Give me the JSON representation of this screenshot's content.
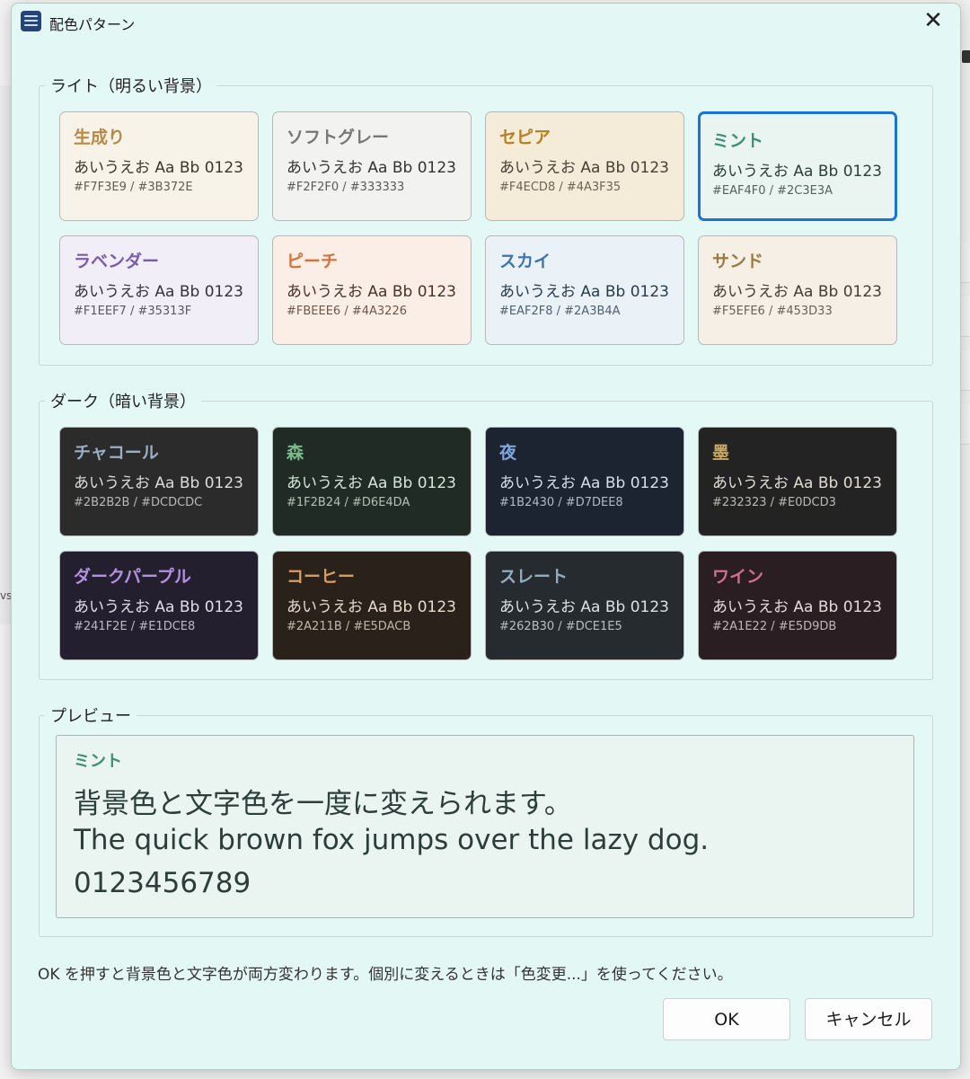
{
  "window": {
    "title": "配色パターン",
    "close_symbol": "✕"
  },
  "background_app": {
    "left_fragment": "vs"
  },
  "light_group": {
    "label": "ライト（明るい背景）",
    "items": [
      {
        "name": "生成り",
        "sample": "あいうえお Aa Bb 0123",
        "codes": "#F7F3E9 / #3B372E",
        "bg": "#F7F3E9",
        "fg": "#3B372E",
        "accent": "#b98a45",
        "selected": false
      },
      {
        "name": "ソフトグレー",
        "sample": "あいうえお Aa Bb 0123",
        "codes": "#F2F2F0 / #333333",
        "bg": "#F2F2F0",
        "fg": "#333333",
        "accent": "#777777",
        "selected": false
      },
      {
        "name": "セピア",
        "sample": "あいうえお Aa Bb 0123",
        "codes": "#F4ECD8 / #4A3F35",
        "bg": "#F4ECD8",
        "fg": "#4A3F35",
        "accent": "#b57f22",
        "selected": false
      },
      {
        "name": "ミント",
        "sample": "あいうえお Aa Bb 0123",
        "codes": "#EAF4F0 / #2C3E3A",
        "bg": "#EAF4F0",
        "fg": "#2C3E3A",
        "accent": "#3b8f73",
        "selected": true
      },
      {
        "name": "ラベンダー",
        "sample": "あいうえお Aa Bb 0123",
        "codes": "#F1EEF7 / #35313F",
        "bg": "#F1EEF7",
        "fg": "#35313F",
        "accent": "#7a5cae",
        "selected": false
      },
      {
        "name": "ピーチ",
        "sample": "あいうえお Aa Bb 0123",
        "codes": "#FBEEE6 / #4A3226",
        "bg": "#FBEEE6",
        "fg": "#4A3226",
        "accent": "#d4723e",
        "selected": false
      },
      {
        "name": "スカイ",
        "sample": "あいうえお Aa Bb 0123",
        "codes": "#EAF2F8 / #2A3B4A",
        "bg": "#EAF2F8",
        "fg": "#2A3B4A",
        "accent": "#3d74ad",
        "selected": false
      },
      {
        "name": "サンド",
        "sample": "あいうえお Aa Bb 0123",
        "codes": "#F5EFE6 / #453D33",
        "bg": "#F5EFE6",
        "fg": "#453D33",
        "accent": "#9c7a45",
        "selected": false
      }
    ]
  },
  "dark_group": {
    "label": "ダーク（暗い背景）",
    "items": [
      {
        "name": "チャコール",
        "sample": "あいうえお Aa Bb 0123",
        "codes": "#2B2B2B / #DCDCDC",
        "bg": "#2B2B2B",
        "fg": "#DCDCDC",
        "accent": "#9aaec7",
        "selected": false
      },
      {
        "name": "森",
        "sample": "あいうえお Aa Bb 0123",
        "codes": "#1F2B24 / #D6E4DA",
        "bg": "#1F2B24",
        "fg": "#D6E4DA",
        "accent": "#7dbb8c",
        "selected": false
      },
      {
        "name": "夜",
        "sample": "あいうえお Aa Bb 0123",
        "codes": "#1B2430 / #D7DEE8",
        "bg": "#1B2430",
        "fg": "#D7DEE8",
        "accent": "#7fa6dc",
        "selected": false
      },
      {
        "name": "墨",
        "sample": "あいうえお Aa Bb 0123",
        "codes": "#232323 / #E0DCD3",
        "bg": "#232323",
        "fg": "#E0DCD3",
        "accent": "#cfa860",
        "selected": false
      },
      {
        "name": "ダークパープル",
        "sample": "あいうえお Aa Bb 0123",
        "codes": "#241F2E / #E1DCE8",
        "bg": "#241F2E",
        "fg": "#E1DCE8",
        "accent": "#b391e0",
        "selected": false
      },
      {
        "name": "コーヒー",
        "sample": "あいうえお Aa Bb 0123",
        "codes": "#2A211B / #E5DACB",
        "bg": "#2A211B",
        "fg": "#E5DACB",
        "accent": "#d99e5e",
        "selected": false
      },
      {
        "name": "スレート",
        "sample": "あいうえお Aa Bb 0123",
        "codes": "#262B30 / #DCE1E5",
        "bg": "#262B30",
        "fg": "#DCE1E5",
        "accent": "#92aebf",
        "selected": false
      },
      {
        "name": "ワイン",
        "sample": "あいうえお Aa Bb 0123",
        "codes": "#2A1E22 / #E5D9DB",
        "bg": "#2A1E22",
        "fg": "#E5D9DB",
        "accent": "#d36f8e",
        "selected": false
      }
    ]
  },
  "preview": {
    "label": "プレビュー",
    "name": "ミント",
    "line1": "背景色と文字色を一度に変えられます。",
    "line2": "The quick brown fox jumps over the lazy dog.",
    "line3": "0123456789",
    "bg": "#EAF4F0",
    "fg": "#2C3E3A",
    "accent": "#3b8f73"
  },
  "footer": {
    "note": "OK を押すと背景色と文字色が両方変わります。個別に変えるときは「色変更...」を使ってください。",
    "ok_label": "OK",
    "cancel_label": "キャンセル"
  }
}
